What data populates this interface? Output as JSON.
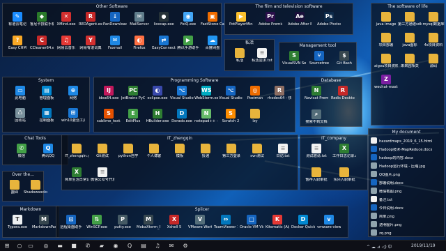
{
  "colors": {
    "fence_bg": "#0a0f19",
    "taskbar": "#0e0f16",
    "accent": "#1e88e5"
  },
  "fences": {
    "other": {
      "title": "Other Software",
      "items": [
        {
          "label": "有道云笔记",
          "icon": "note-icon",
          "color": "#1a8cff",
          "glyph": "✎"
        },
        {
          "label": "鲁尼卡技联手机v5_0 - 026...",
          "icon": "app-icon",
          "color": "#2a7a2a",
          "glyph": "◆"
        },
        {
          "label": "XMind.exe",
          "icon": "xmind-icon",
          "color": "#d32f2f",
          "glyph": "✕"
        },
        {
          "label": "REDAgent.exe",
          "icon": "redagent-icon",
          "color": "#c62828",
          "glyph": "R"
        },
        {
          "label": "PanDownload.exe",
          "icon": "pandownload-icon",
          "color": "#1565c0",
          "glyph": "↓"
        },
        {
          "label": "MailServer",
          "icon": "mail-icon",
          "color": "#607d8b",
          "glyph": "✉"
        },
        {
          "label": "licecap.exe",
          "icon": "licecap-icon",
          "color": "#263238",
          "glyph": "●"
        },
        {
          "label": "FeiQ.exe",
          "icon": "feiq-icon",
          "color": "#42a5f5",
          "glyph": "◉"
        },
        {
          "label": "FastStone Capture 8.0",
          "icon": "faststone-icon",
          "color": "#ef6c00",
          "glyph": "▣"
        },
        {
          "label": "Easy CHM",
          "icon": "chm-icon",
          "color": "#f9a825",
          "glyph": "?"
        },
        {
          "label": "CCleaner64.exe",
          "icon": "ccleaner-icon",
          "color": "#c62828",
          "glyph": "C"
        },
        {
          "label": "网易云音乐",
          "icon": "cloudmusic-icon",
          "color": "#e53935",
          "glyph": "♫"
        },
        {
          "label": "网易有道词典",
          "icon": "youdao-icon",
          "color": "#d32f2f",
          "glyph": "Y"
        },
        {
          "label": "Foxmail",
          "icon": "foxmail-icon",
          "color": "#1e88e5",
          "glyph": "✉"
        },
        {
          "label": "Firefox",
          "icon": "firefox-icon",
          "color": "#ff7043",
          "glyph": "◐"
        },
        {
          "label": "EasyConnect",
          "icon": "easyconnect-icon",
          "color": "#1976d2",
          "glyph": "⇄"
        },
        {
          "label": "腾讯手游助手",
          "icon": "game-icon",
          "color": "#43a047",
          "glyph": "▶"
        },
        {
          "label": "百度网盘",
          "icon": "baidu-icon",
          "color": "#2196f3",
          "glyph": "☁"
        }
      ]
    },
    "film": {
      "title": "The film and television software",
      "items": [
        {
          "label": "PotPlayerMini64.exe",
          "icon": "potplayer-icon",
          "color": "#fbc02d",
          "glyph": "▶"
        },
        {
          "label": "Adobe Premiere Pro CC...",
          "icon": "premiere-icon",
          "color": "#2a0f4a",
          "glyph": "Pr"
        },
        {
          "label": "Adobe After Effects CC...",
          "icon": "aftereffects-icon",
          "color": "#1a0f3a",
          "glyph": "Ae"
        },
        {
          "label": "Adobe Photoshop CC",
          "icon": "photoshop-icon",
          "color": "#0d2a4a",
          "glyph": "Ps"
        }
      ]
    },
    "life": {
      "title": "The software of life",
      "items": [
        {
          "label": "java image",
          "icon": "folder-icon",
          "folder": true
        },
        {
          "label": "第三方通道sdk",
          "icon": "folder-icon",
          "folder": true
        },
        {
          "label": "mysql数据库",
          "icon": "folder-icon",
          "folder": true
        },
        {
          "label": "项目部署",
          "icon": "folder-icon",
          "folder": true
        },
        {
          "label": "java图标",
          "icon": "folder-icon",
          "folder": true
        },
        {
          "label": "4s项目资料",
          "icon": "folder-icon",
          "folder": true
        },
        {
          "label": "aigou项目资料",
          "icon": "folder-icon",
          "folder": true
        },
        {
          "label": "来来园相关",
          "icon": "folder-icon",
          "folder": true
        },
        {
          "label": "源码",
          "icon": "folder-icon",
          "folder": true
        },
        {
          "label": "wechat-master.zip",
          "icon": "zip-icon",
          "color": "#7b1fa2",
          "glyph": "Z"
        }
      ]
    },
    "private": {
      "title": "私活",
      "items": [
        {
          "label": "私活",
          "icon": "folder-icon",
          "folder": true
        },
        {
          "label": "私活需求.txt",
          "icon": "text-file-icon",
          "file": true
        }
      ]
    },
    "mgmt": {
      "title": "Management tool",
      "items": [
        {
          "label": "VisualSVN Server.msc",
          "icon": "svn-icon",
          "color": "#2e7d32",
          "glyph": "S"
        },
        {
          "label": "Sourcetree",
          "icon": "sourcetree-icon",
          "color": "#1565c0",
          "glyph": "⑂"
        },
        {
          "label": "Git Bash",
          "icon": "gitbash-icon",
          "color": "#37474f",
          "glyph": "$"
        }
      ]
    },
    "system": {
      "title": "System",
      "items": [
        {
          "label": "此电脑",
          "icon": "computer-icon",
          "color": "#1e88e5",
          "glyph": "▭"
        },
        {
          "label": "管理面板",
          "icon": "panel-icon",
          "color": "#0288d1",
          "glyph": "▤"
        },
        {
          "label": "网络",
          "icon": "network-icon",
          "color": "#1e88e5",
          "glyph": "⊕"
        },
        {
          "label": "回收站",
          "icon": "recycle-icon",
          "color": "#78909c",
          "glyph": "♺"
        },
        {
          "label": "控制面板",
          "icon": "control-panel-icon",
          "color": "#0277bd",
          "glyph": "▦"
        },
        {
          "label": "win10激活工具",
          "icon": "win10-icon",
          "color": "#1976d2",
          "glyph": "⊞"
        }
      ]
    },
    "prog": {
      "title": "Programming Software",
      "items": [
        {
          "label": "idea64.exe",
          "icon": "idea-icon",
          "color": "#c2185b",
          "glyph": "IJ"
        },
        {
          "label": "JetBrains PyCharm 201...",
          "icon": "pycharm-icon",
          "color": "#2e7d32",
          "glyph": "PC"
        },
        {
          "label": "eclipse.exe",
          "icon": "eclipse-icon",
          "color": "#3949ab",
          "glyph": "◐"
        },
        {
          "label": "Visual Studio Code",
          "icon": "vscode-icon",
          "color": "#1976d2",
          "glyph": "⌥"
        },
        {
          "label": "WebStorm.exe - 快捷方式",
          "icon": "webstorm-icon",
          "color": "#00acc1",
          "glyph": "WS"
        },
        {
          "label": "Visual Studio Code",
          "icon": "vscode-icon",
          "color": "#1565c0",
          "glyph": "⌥"
        },
        {
          "label": "Postman",
          "icon": "postman-icon",
          "color": "#ef6c00",
          "glyph": "◎"
        },
        {
          "label": "rhodes64 - 快捷方式",
          "icon": "rhodes-icon",
          "color": "#8d6e63",
          "glyph": "R"
        },
        {
          "label": "sublime_text.exe",
          "icon": "sublime-icon",
          "color": "#e65100",
          "glyph": "S"
        },
        {
          "label": "EditPlus",
          "icon": "editplus-icon",
          "color": "#43a047",
          "glyph": "E"
        },
        {
          "label": "HBuilder.exe",
          "icon": "hbuilder-icon",
          "color": "#2e7d32",
          "glyph": "H"
        },
        {
          "label": "Dorado.exe",
          "icon": "dorado-icon",
          "color": "#0277bd",
          "glyph": "D"
        },
        {
          "label": "notepad++ - 快捷方式",
          "icon": "notepad-icon",
          "color": "#66bb6a",
          "glyph": "N"
        },
        {
          "label": "Scratch 2",
          "icon": "scratch-icon",
          "color": "#fb8c00",
          "glyph": "S"
        },
        {
          "label": "lzy",
          "icon": "folder-icon",
          "folder": true
        }
      ]
    },
    "db": {
      "title": "Database",
      "items": [
        {
          "label": "Navicat Premium 12",
          "icon": "navicat-icon",
          "color": "#2e7d32",
          "glyph": "N"
        },
        {
          "label": "Redis Desktop Manager",
          "icon": "redis-icon",
          "color": "#c62828",
          "glyph": "R"
        },
        {
          "label": "搜索不到文档",
          "icon": "search-icon",
          "color": "#546e7a",
          "glyph": "⌕"
        }
      ]
    },
    "chat": {
      "title": "Chat Tools",
      "items": [
        {
          "label": "微信",
          "icon": "wechat-icon",
          "color": "#43a047",
          "glyph": "✆"
        },
        {
          "label": "腾讯QQ",
          "icon": "qq-icon",
          "color": "#1e88e5",
          "glyph": "Q"
        }
      ]
    },
    "zheng": {
      "title": "IT_zhengqin",
      "items": [
        {
          "label": "IT_zhengqin.g",
          "icon": "folder-icon",
          "folder": true
        },
        {
          "label": "Git测试",
          "icon": "folder-icon",
          "folder": true
        },
        {
          "label": "python自学",
          "icon": "folder-icon",
          "folder": true
        },
        {
          "label": "个人博客",
          "icon": "folder-icon",
          "folder": true
        },
        {
          "label": "模板",
          "icon": "folder-icon",
          "folder": true
        },
        {
          "label": "投递",
          "icon": "folder-icon",
          "folder": true
        },
        {
          "label": "第三方登录",
          "icon": "folder-icon",
          "folder": true
        },
        {
          "label": "svn测试",
          "icon": "folder-icon",
          "folder": true
        },
        {
          "label": "日记.txt",
          "icon": "text-file-icon",
          "file": true
        },
        {
          "label": "简单生活日常记录表.xls",
          "icon": "excel-icon",
          "color": "#2e7d32",
          "glyph": "X"
        },
        {
          "label": "微信公众号开发.md",
          "icon": "markdown-file-icon",
          "file": true
        }
      ]
    },
    "company": {
      "title": "IT_company",
      "items": [
        {
          "label": "测试邀请.txt",
          "icon": "text-file-icon",
          "file": true
        },
        {
          "label": "工作日志记录.xls",
          "icon": "excel-icon",
          "color": "#2e7d32",
          "glyph": "X"
        },
        {
          "label": "暂存入职审批",
          "icon": "folder-icon",
          "folder": true
        },
        {
          "label": "东兴入职审批",
          "icon": "folder-icon",
          "folder": true
        }
      ]
    },
    "over": {
      "title": "Over the...",
      "items": [
        {
          "label": "翻译",
          "icon": "translate-icon",
          "folder": true
        },
        {
          "label": "Shadowsocks",
          "icon": "shadowsocks-icon",
          "folder": true
        }
      ]
    },
    "md": {
      "title": "Markdown",
      "items": [
        {
          "label": "Typora.exe",
          "icon": "typora-icon",
          "color": "#eceff1",
          "glyph": "T",
          "dark": true
        },
        {
          "label": "MarkdownPad 2",
          "icon": "markdownpad-icon",
          "color": "#37474f",
          "glyph": "M"
        }
      ]
    },
    "splicer": {
      "title": "Splicer",
      "items": [
        {
          "label": "远程桌面助手",
          "icon": "remote-desktop-icon",
          "color": "#1565c0",
          "glyph": "⊡"
        },
        {
          "label": "WinSCP.exe",
          "icon": "winscp-icon",
          "color": "#43a047",
          "glyph": "⇅"
        },
        {
          "label": "putty.exe",
          "icon": "putty-icon",
          "color": "#455a64",
          "glyph": "P"
        },
        {
          "label": "MobaXterm_Personal_1...",
          "icon": "mobaxterm-icon",
          "color": "#37474f",
          "glyph": "M"
        },
        {
          "label": "Xshell 5",
          "icon": "xshell-icon",
          "color": "#c62828",
          "glyph": "X"
        },
        {
          "label": "VMware Workstation Pro",
          "icon": "vmware-icon",
          "color": "#546e7a",
          "glyph": "V"
        },
        {
          "label": "TeamViewer 14",
          "icon": "teamviewer-icon",
          "color": "#0277bd",
          "glyph": "⇔"
        },
        {
          "label": "Oracle VM VirtualBox",
          "icon": "virtualbox-icon",
          "color": "#1565c0",
          "glyph": "□"
        },
        {
          "label": "Kitematic (Alpha)",
          "icon": "kitematic-icon",
          "color": "#e53935",
          "glyph": "K"
        },
        {
          "label": "Docker Quickstart Termin...",
          "icon": "docker-icon",
          "color": "#0288d1",
          "glyph": "D"
        },
        {
          "label": "vmware-view.exe",
          "icon": "vmware-view-icon",
          "color": "#1e88e5",
          "glyph": "v"
        }
      ]
    },
    "mydoc": {
      "title": "My document",
      "items": [
        {
          "label": "hazardmaps_2019_6_15.html",
          "icon": "html-file-icon",
          "color": "#f2f2f2"
        },
        {
          "label": "Hadoop技术-MapReduce.docx",
          "icon": "word-icon",
          "color": "#1565c0"
        },
        {
          "label": "hadoop的内容.docx",
          "icon": "word-icon",
          "color": "#1565c0"
        },
        {
          "label": "Hadoop运行环境 - 压缩.jpg",
          "icon": "image-icon",
          "color": "#90a4ae"
        },
        {
          "label": "QQ图片.png",
          "icon": "image-icon",
          "color": "#90a4ae"
        },
        {
          "label": "部署说明.docx",
          "icon": "word-icon",
          "color": "#1565c0"
        },
        {
          "label": "微信截图.png",
          "icon": "image-icon",
          "color": "#90a4ae"
        },
        {
          "label": "备注.txt",
          "icon": "text-file-icon",
          "color": "#f2f2f2"
        },
        {
          "label": "今日说明.docx",
          "icon": "word-icon",
          "color": "#1565c0"
        },
        {
          "label": "简单.png",
          "icon": "image-icon",
          "color": "#90a4ae"
        },
        {
          "label": "透明图片.png",
          "icon": "image-icon",
          "color": "#90a4ae"
        },
        {
          "label": "zq.png",
          "icon": "image-icon",
          "color": "#90a4ae"
        }
      ]
    }
  },
  "taskbar": {
    "clock": "2019/11/19",
    "items": [
      {
        "icon": "windows-start-icon",
        "glyph": "⊞"
      },
      {
        "icon": "search-icon",
        "glyph": "○"
      },
      {
        "icon": "task-view-icon",
        "glyph": "▭"
      },
      {
        "icon": "browser-icon",
        "glyph": "◎"
      },
      {
        "icon": "file-explorer-icon",
        "glyph": "▬"
      },
      {
        "icon": "idea-taskbar-icon",
        "glyph": "■"
      },
      {
        "icon": "wechat-taskbar-icon",
        "glyph": "✆"
      },
      {
        "icon": "folder-taskbar-icon",
        "glyph": "▰"
      },
      {
        "icon": "chrome-taskbar-icon",
        "glyph": "◉"
      },
      {
        "icon": "qq-taskbar-icon",
        "glyph": "Q"
      },
      {
        "icon": "terminal-taskbar-icon",
        "glyph": "▤"
      },
      {
        "icon": "music-taskbar-icon",
        "glyph": "♫"
      },
      {
        "icon": "mail-taskbar-icon",
        "glyph": "✉"
      },
      {
        "icon": "settings-taskbar-icon",
        "glyph": "⚙"
      }
    ],
    "tray": "^ ☁ ⊿ ◁) 中"
  }
}
